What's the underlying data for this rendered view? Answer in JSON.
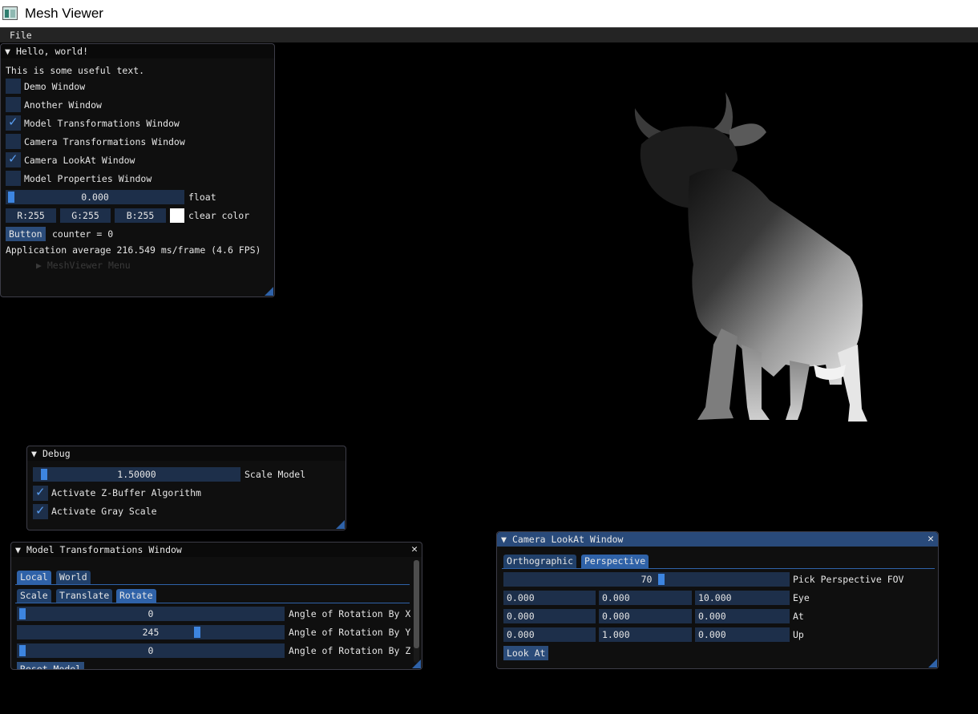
{
  "app": {
    "title": "Mesh Viewer"
  },
  "menubar": {
    "file": "File"
  },
  "hello": {
    "title": "Hello, world!",
    "text": "This is some useful text.",
    "checkboxes": [
      {
        "label": "Demo Window",
        "checked": false
      },
      {
        "label": "Another Window",
        "checked": false
      },
      {
        "label": "Model Transformations Window",
        "checked": true
      },
      {
        "label": "Camera Transformations Window",
        "checked": false
      },
      {
        "label": "Camera LookAt Window",
        "checked": true
      },
      {
        "label": "Model Properties Window",
        "checked": false
      }
    ],
    "float_value": "0.000",
    "float_label": "float",
    "r": "R:255",
    "g": "G:255",
    "b": "B:255",
    "clear_label": "clear color",
    "button": "Button",
    "counter": "counter = 0",
    "fps": "Application average 216.549 ms/frame (4.6 FPS)",
    "submenu": "MeshViewer Menu"
  },
  "debug": {
    "title": "Debug",
    "scale_value": "1.50000",
    "scale_label": "Scale Model",
    "zbuffer": "Activate Z-Buffer Algorithm",
    "grayscale": "Activate Gray Scale"
  },
  "model": {
    "title": "Model Transformations Window",
    "tabs1": [
      "Local",
      "World"
    ],
    "tabs2": [
      "Scale",
      "Translate",
      "Rotate"
    ],
    "sliders": [
      {
        "value": "0",
        "label": "Angle of Rotation By X"
      },
      {
        "value": "245",
        "label": "Angle of Rotation By Y"
      },
      {
        "value": "0",
        "label": "Angle of Rotation By Z"
      }
    ],
    "reset": "Reset Model"
  },
  "camera": {
    "title": "Camera LookAt Window",
    "tabs": [
      "Orthographic",
      "Perspective"
    ],
    "fov_value": "70",
    "fov_label": "Pick Perspective FOV",
    "rows": [
      {
        "x": "0.000",
        "y": "0.000",
        "z": "10.000",
        "label": "Eye"
      },
      {
        "x": "0.000",
        "y": "0.000",
        "z": "0.000",
        "label": "At"
      },
      {
        "x": "0.000",
        "y": "1.000",
        "z": "0.000",
        "label": "Up"
      }
    ],
    "lookat": "Look At"
  }
}
